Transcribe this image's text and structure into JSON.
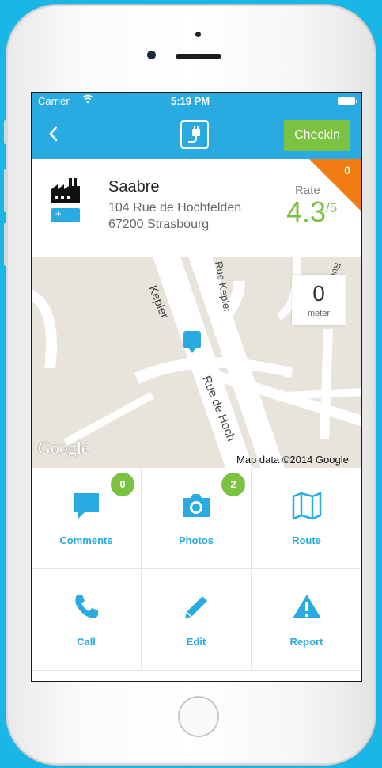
{
  "status_bar": {
    "carrier": "Carrier",
    "wifi_icon": "wifi-icon",
    "time": "5:19 PM",
    "battery_icon": "battery-icon"
  },
  "nav": {
    "back_icon": "chevron-left-icon",
    "logo_icon": "charging-plug-icon",
    "checkin_label": "Checkin"
  },
  "station": {
    "name": "Saabre",
    "address_line1": "104 Rue de Hochfelden",
    "address_line2": "67200 Strasbourg",
    "rate_label": "Rate",
    "rate_value": "4.3",
    "rate_max": "/5",
    "corner_count": "0",
    "colors": {
      "accent": "#29abe2",
      "green": "#7cc242",
      "orange": "#f07c12"
    }
  },
  "map": {
    "street_labels": [
      "Kepler",
      "Rue Kepler",
      "Rue de Hoch",
      "Rue de Noye"
    ],
    "google_logo": "Google",
    "credit": "Map data ©2014 Google",
    "distance_value": "0",
    "distance_unit": "meter"
  },
  "actions": [
    {
      "label": "Comments",
      "icon": "comment-icon",
      "badge": "0"
    },
    {
      "label": "Photos",
      "icon": "camera-icon",
      "badge": "2"
    },
    {
      "label": "Route",
      "icon": "map-icon",
      "badge": null
    },
    {
      "label": "Call",
      "icon": "phone-icon",
      "badge": null
    },
    {
      "label": "Edit",
      "icon": "pencil-icon",
      "badge": null
    },
    {
      "label": "Report",
      "icon": "warning-icon",
      "badge": null
    }
  ]
}
